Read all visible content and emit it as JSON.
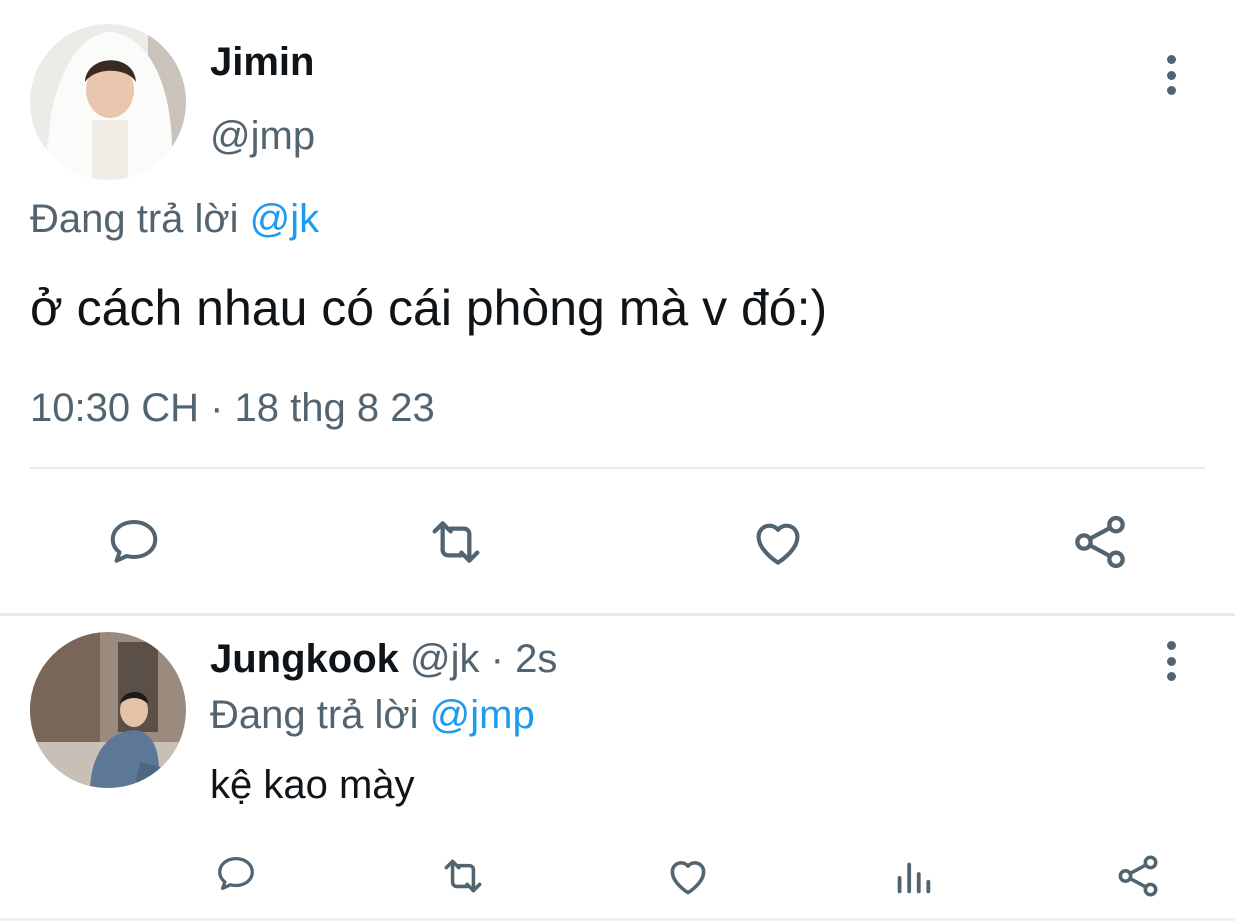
{
  "main_tweet": {
    "display_name": "Jimin",
    "handle": "@jmp",
    "reply_prefix": "Đang trả lời",
    "reply_to": "@jk",
    "text": "ở cách nhau có cái phòng mà v đó:)",
    "timestamp": "10:30 CH · 18 thg 8 23",
    "actions": [
      "reply-icon",
      "retweet-icon",
      "like-icon",
      "share-icon"
    ]
  },
  "reply_tweet": {
    "display_name": "Jungkook",
    "handle": "@jk",
    "time_ago": "· 2s",
    "reply_prefix": "Đang trả lời",
    "reply_to": "@jmp",
    "text": "kệ kao mày",
    "actions": [
      "reply-icon",
      "retweet-icon",
      "like-icon",
      "views-icon",
      "share-icon"
    ]
  },
  "colors": {
    "text": "#0f1419",
    "secondary": "#536471",
    "link": "#1d9bf0",
    "divider": "#e7eaec"
  }
}
